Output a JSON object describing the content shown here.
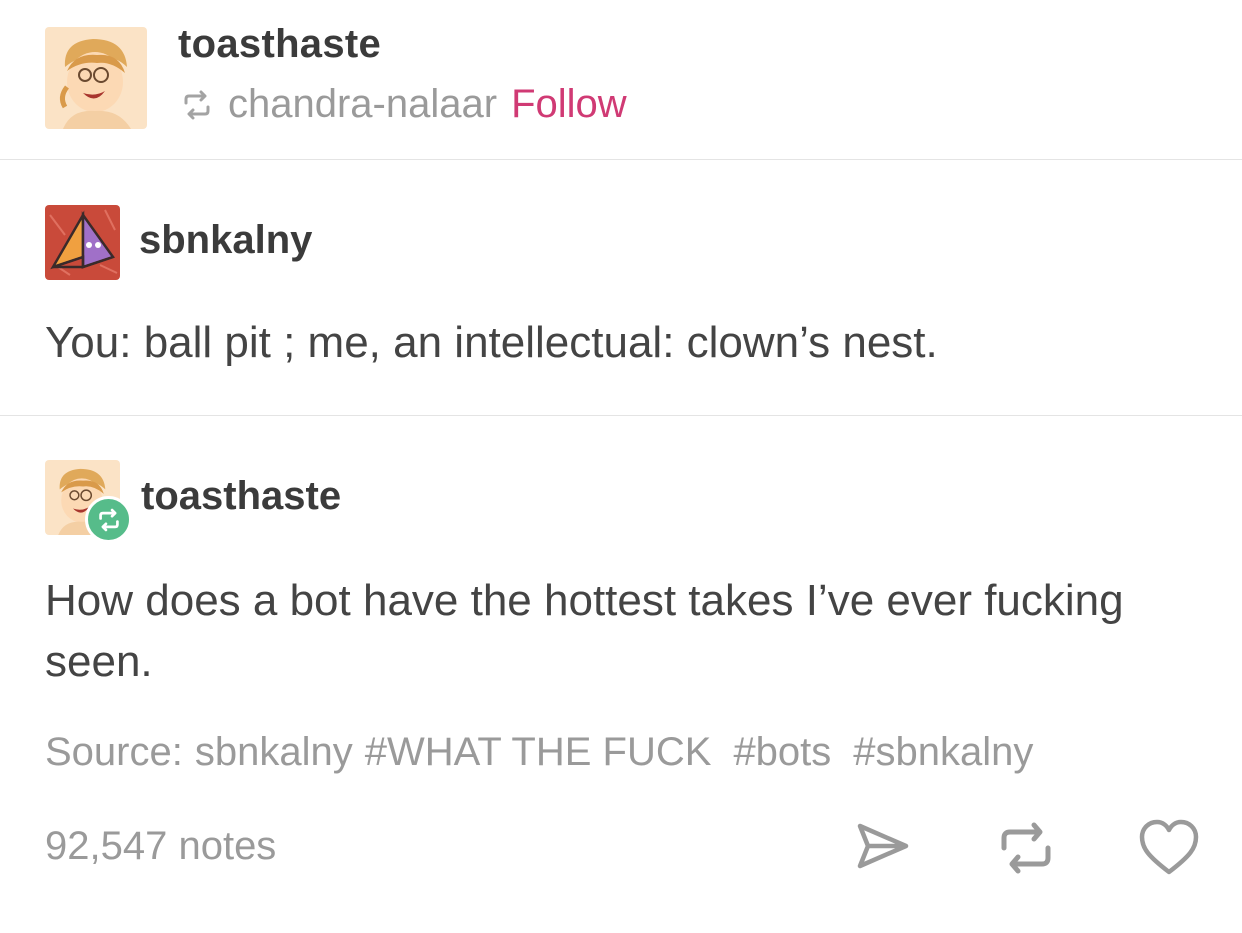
{
  "header": {
    "blog_name": "toasthaste",
    "reblogged_from": "chandra-nalaar",
    "follow_label": "Follow",
    "avatar_icon": "cartoon-avatar-icon",
    "reblog_icon": "reblog-icon"
  },
  "trail": [
    {
      "blog_name": "sbnkalny",
      "avatar_icon": "pyramid-avatar-icon",
      "body": "You: ball pit ; me, an intellectual: clown’s nest."
    },
    {
      "blog_name": "toasthaste",
      "avatar_icon": "cartoon-avatar-icon",
      "badge_icon": "reblog-badge-icon",
      "body": "How does a bot have the hottest takes I’ve ever fucking seen."
    }
  ],
  "tags": {
    "source_label": "Source:",
    "source_name": "sbnkalny",
    "items": [
      "#WHAT THE FUCK",
      "#bots",
      "#sbnkalny"
    ]
  },
  "footer": {
    "notes": "92,547 notes",
    "share_icon": "share-icon",
    "reblog_icon": "reblog-icon",
    "like_icon": "heart-icon"
  },
  "colors": {
    "accent_follow": "#d03a74",
    "reblog_green": "#56bc8a",
    "text_primary": "#444444",
    "text_muted": "#9a9a9a",
    "divider": "#e4e4e4"
  }
}
